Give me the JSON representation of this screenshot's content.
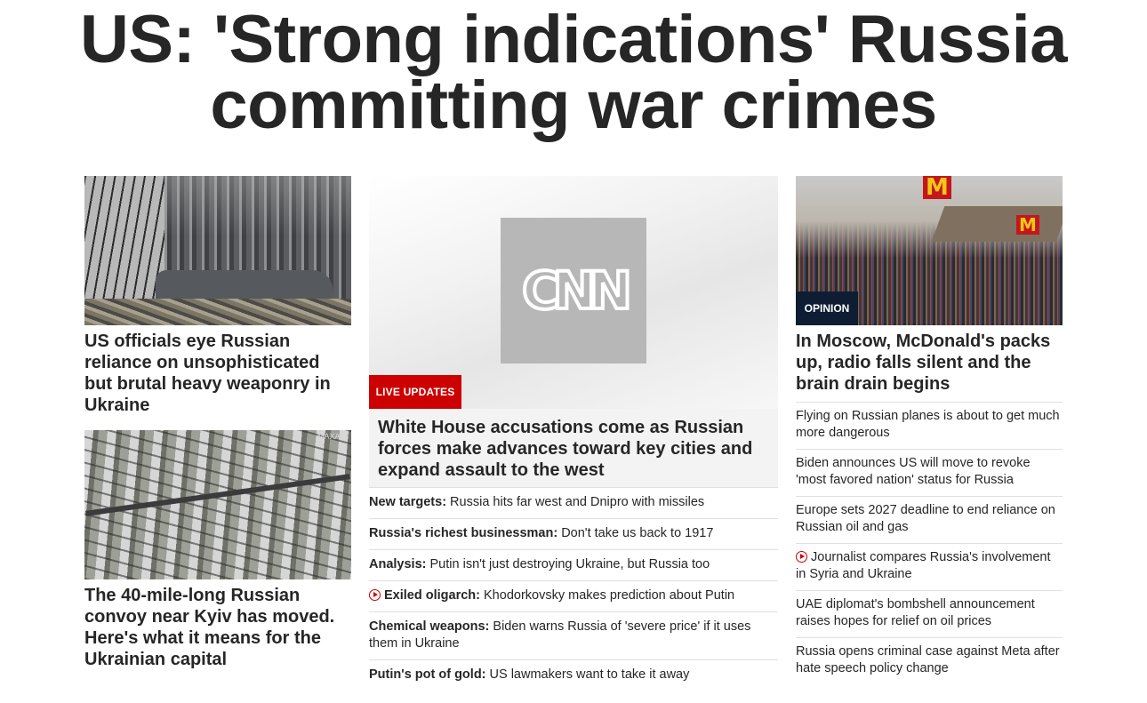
{
  "headline": {
    "line1": "US: 'Strong indications' Russia",
    "line2": "committing war crimes"
  },
  "left": {
    "stories": [
      {
        "image": "war-damaged-building-and-cars-photo",
        "title": "US officials eye Russian reliance on unsophisticated but brutal heavy weaponry in Ukraine"
      },
      {
        "image": "satellite-image-convoy-photo",
        "image_watermark": "MAXAR",
        "title": "The 40-mile-long Russian convoy near Kyiv has moved. Here's what it means for the Ukrainian capital"
      }
    ]
  },
  "middle": {
    "logo_text": "CNN",
    "badge": "LIVE UPDATES",
    "title": "White House accusations come as Russian forces make advances toward key cities and expand assault to the west",
    "items": [
      {
        "lead": "New targets:",
        "text": " Russia hits far west and Dnipro with missiles",
        "video": false
      },
      {
        "lead": "Russia's richest businessman:",
        "text": " Don't take us back to 1917",
        "video": false
      },
      {
        "lead": "Analysis:",
        "text": " Putin isn't just destroying Ukraine, but Russia too",
        "video": false
      },
      {
        "lead": "Exiled oligarch:",
        "text": " Khodorkovsky makes prediction about Putin",
        "video": true
      },
      {
        "lead": "Chemical weapons:",
        "text": " Biden warns Russia of 'severe price' if it uses them in Ukraine",
        "video": false
      },
      {
        "lead": "Putin's pot of gold:",
        "text": " US lawmakers want to take it away",
        "video": false
      }
    ]
  },
  "right": {
    "image": "moscow-mcdonalds-crowd-photo",
    "sign_text": "M",
    "badge": "OPINION",
    "title": "In Moscow, McDonald's packs up, radio falls silent and the brain drain begins",
    "items": [
      {
        "text": "Flying on Russian planes is about to get much more dangerous",
        "video": false
      },
      {
        "text": "Biden announces US will move to revoke 'most favored nation' status for Russia",
        "video": false
      },
      {
        "text": "Europe sets 2027 deadline to end reliance on Russian oil and gas",
        "video": false
      },
      {
        "text": "Journalist compares Russia's involvement in Syria and Ukraine",
        "video": true
      },
      {
        "text": "UAE diplomat's bombshell announcement raises hopes for relief on oil prices",
        "video": false
      },
      {
        "text": "Russia opens criminal case against Meta after hate speech policy change",
        "video": false
      }
    ]
  },
  "colors": {
    "live_badge": "#cc0000",
    "opinion_badge": "#0e1d33",
    "text": "#262626",
    "play_icon": "#cc0000"
  }
}
